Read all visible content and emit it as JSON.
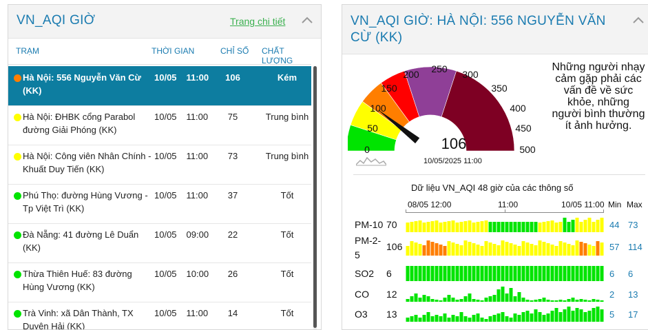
{
  "left_panel": {
    "title": "VN_AQI GIỜ",
    "detail_link": "Trang chi tiết",
    "columns": {
      "station": "TRẠM",
      "time": "THỜI GIAN",
      "index": "CHỈ SỐ",
      "quality": "CHẤT LƯỢNG"
    },
    "rows": [
      {
        "name": "Hà Nội: 556 Nguyễn Văn Cừ (KK)",
        "date": "10/05",
        "time": "11:00",
        "index": "106",
        "quality": "Kém",
        "color": "#ff7e00",
        "selected": true
      },
      {
        "name": "Hà Nội: ĐHBK cổng Parabol đường Giải Phóng (KK)",
        "date": "10/05",
        "time": "11:00",
        "index": "75",
        "quality": "Trung bình",
        "color": "#ffff00"
      },
      {
        "name": "Hà Nội: Công viên Nhân Chính - Khuất Duy Tiến (KK)",
        "date": "10/05",
        "time": "11:00",
        "index": "73",
        "quality": "Trung bình",
        "color": "#ffff00"
      },
      {
        "name": "Phú Thọ: đường Hùng Vương - Tp Việt Trì (KK)",
        "date": "10/05",
        "time": "11:00",
        "index": "37",
        "quality": "Tốt",
        "color": "#00e400"
      },
      {
        "name": "Đà Nẵng: 41 đường Lê Duẩn (KK)",
        "date": "10/05",
        "time": "09:00",
        "index": "22",
        "quality": "Tốt",
        "color": "#00e400"
      },
      {
        "name": "Thừa Thiên Huế: 83 đường Hùng Vương (KK)",
        "date": "10/05",
        "time": "10:00",
        "index": "26",
        "quality": "Tốt",
        "color": "#00e400"
      },
      {
        "name": "Trà Vinh: xã Dân Thành, TX Duyên Hải (KK)",
        "date": "10/05",
        "time": "11:00",
        "index": "14",
        "quality": "Tốt",
        "color": "#00e400"
      }
    ]
  },
  "right_panel": {
    "title": "VN_AQI GIỜ: HÀ NỘI: 556 NGUYỄN VĂN CỪ (KK)",
    "gauge": {
      "value": "106",
      "timestamp": "10/05/2025 11:00",
      "scale_labels": [
        "0",
        "50",
        "100",
        "150",
        "200",
        "250",
        "300",
        "350",
        "400",
        "450",
        "500"
      ],
      "colors": [
        "#00e400",
        "#ffff00",
        "#ff7e00",
        "#ff0000",
        "#8f3f97",
        "#7e0023"
      ],
      "value_num": 106
    },
    "health_note": "Những người nhạy cảm gặp phải các vấn đề về sức khỏe, những người bình thường ít ảnh hưởng.",
    "table": {
      "title": "Dữ liệu VN_AQI 48 giờ của các thông số",
      "time_labels": [
        "08/05 12:00",
        "11:00",
        "10/05 11:00"
      ],
      "min_header": "Min",
      "max_header": "Max",
      "params": [
        {
          "name": "PM-10",
          "value": "70",
          "min": "44",
          "max": "73"
        },
        {
          "name": "PM-2-5",
          "value": "106",
          "min": "57",
          "max": "114"
        },
        {
          "name": "SO2",
          "value": "6",
          "min": "6",
          "max": "6"
        },
        {
          "name": "CO",
          "value": "12",
          "min": "2",
          "max": "13"
        },
        {
          "name": "O3",
          "value": "13",
          "min": "5",
          "max": "17"
        }
      ],
      "colors": {
        "good": "#00e400",
        "moderate": "#ffff00",
        "poor": "#ff7e00"
      }
    }
  }
}
